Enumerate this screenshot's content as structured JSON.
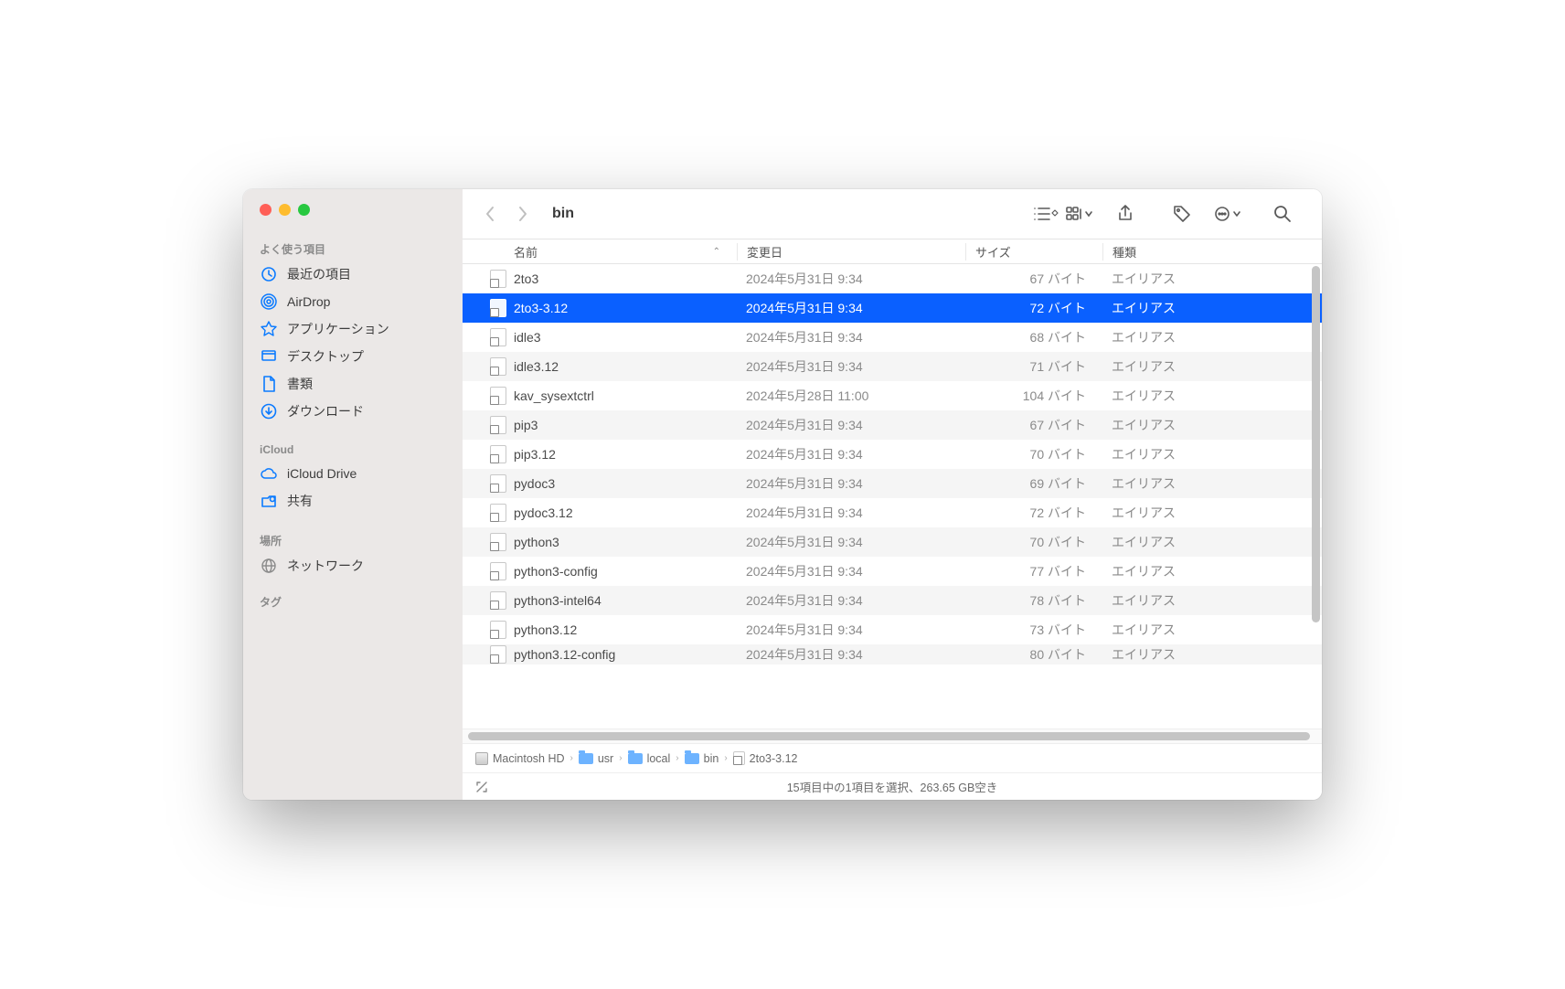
{
  "window": {
    "title": "bin"
  },
  "sidebar": {
    "sections": [
      {
        "header": "よく使う項目",
        "items": [
          {
            "icon": "clock",
            "label": "最近の項目"
          },
          {
            "icon": "airdrop",
            "label": "AirDrop"
          },
          {
            "icon": "apps",
            "label": "アプリケーション"
          },
          {
            "icon": "desktop",
            "label": "デスクトップ"
          },
          {
            "icon": "doc",
            "label": "書類"
          },
          {
            "icon": "download",
            "label": "ダウンロード"
          }
        ]
      },
      {
        "header": "iCloud",
        "items": [
          {
            "icon": "cloud",
            "label": "iCloud Drive"
          },
          {
            "icon": "shared",
            "label": "共有"
          }
        ]
      },
      {
        "header": "場所",
        "items": [
          {
            "icon": "network",
            "label": "ネットワーク",
            "gray": true
          }
        ]
      }
    ],
    "tags_header": "タグ"
  },
  "columns": {
    "name": "名前",
    "modified": "変更日",
    "size": "サイズ",
    "kind": "種類"
  },
  "files": [
    {
      "name": "2to3",
      "date": "2024年5月31日 9:34",
      "size": "67 バイト",
      "kind": "エイリアス",
      "selected": false
    },
    {
      "name": "2to3-3.12",
      "date": "2024年5月31日 9:34",
      "size": "72 バイト",
      "kind": "エイリアス",
      "selected": true
    },
    {
      "name": "idle3",
      "date": "2024年5月31日 9:34",
      "size": "68 バイト",
      "kind": "エイリアス",
      "selected": false
    },
    {
      "name": "idle3.12",
      "date": "2024年5月31日 9:34",
      "size": "71 バイト",
      "kind": "エイリアス",
      "selected": false
    },
    {
      "name": "kav_sysextctrl",
      "date": "2024年5月28日 11:00",
      "size": "104 バイト",
      "kind": "エイリアス",
      "selected": false
    },
    {
      "name": "pip3",
      "date": "2024年5月31日 9:34",
      "size": "67 バイト",
      "kind": "エイリアス",
      "selected": false
    },
    {
      "name": "pip3.12",
      "date": "2024年5月31日 9:34",
      "size": "70 バイト",
      "kind": "エイリアス",
      "selected": false
    },
    {
      "name": "pydoc3",
      "date": "2024年5月31日 9:34",
      "size": "69 バイト",
      "kind": "エイリアス",
      "selected": false
    },
    {
      "name": "pydoc3.12",
      "date": "2024年5月31日 9:34",
      "size": "72 バイト",
      "kind": "エイリアス",
      "selected": false
    },
    {
      "name": "python3",
      "date": "2024年5月31日 9:34",
      "size": "70 バイト",
      "kind": "エイリアス",
      "selected": false
    },
    {
      "name": "python3-config",
      "date": "2024年5月31日 9:34",
      "size": "77 バイト",
      "kind": "エイリアス",
      "selected": false
    },
    {
      "name": "python3-intel64",
      "date": "2024年5月31日 9:34",
      "size": "78 バイト",
      "kind": "エイリアス",
      "selected": false
    },
    {
      "name": "python3.12",
      "date": "2024年5月31日 9:34",
      "size": "73 バイト",
      "kind": "エイリアス",
      "selected": false
    },
    {
      "name": "python3.12-config",
      "date": "2024年5月31日 9:34",
      "size": "80 バイト",
      "kind": "エイリアス",
      "selected": false,
      "cutoff": true
    }
  ],
  "pathbar": [
    {
      "icon": "hd",
      "label": "Macintosh HD"
    },
    {
      "icon": "folder",
      "label": "usr"
    },
    {
      "icon": "folder",
      "label": "local"
    },
    {
      "icon": "folder",
      "label": "bin"
    },
    {
      "icon": "file",
      "label": "2to3-3.12"
    }
  ],
  "status": "15項目中の1項目を選択、263.65 GB空き"
}
